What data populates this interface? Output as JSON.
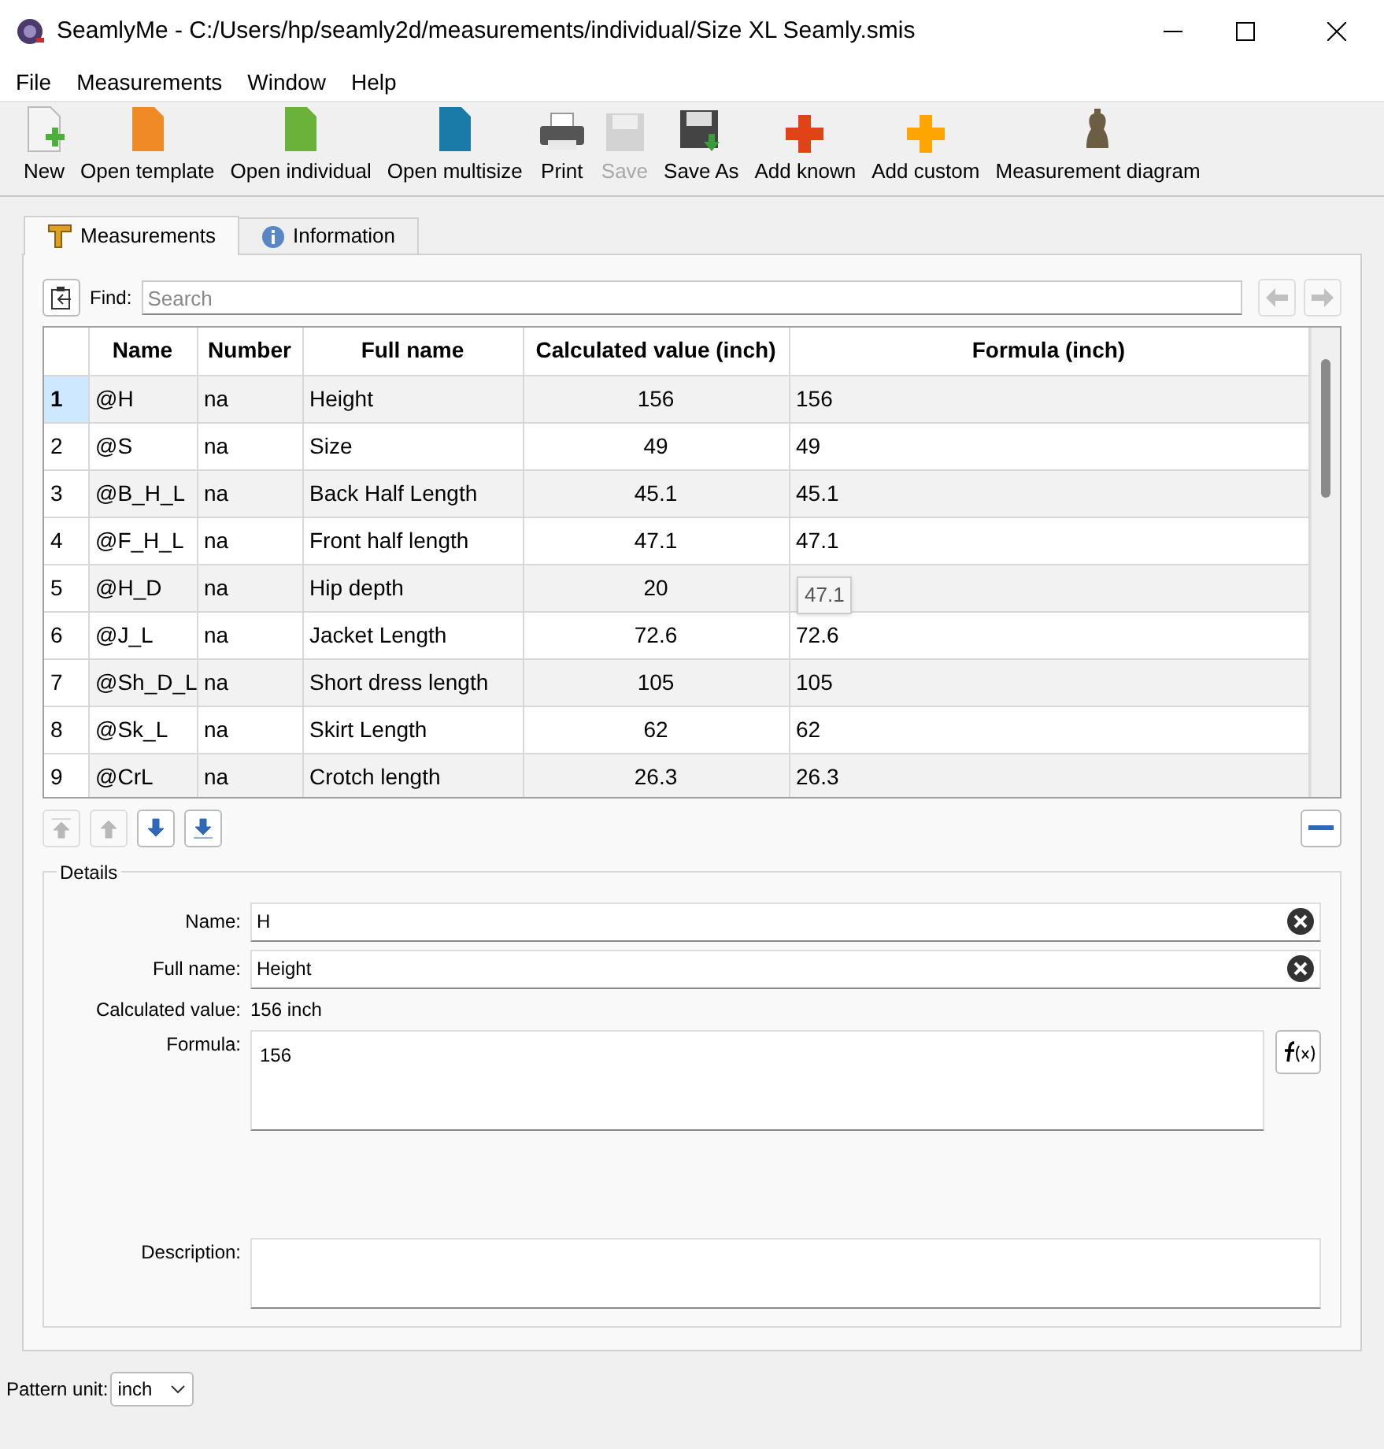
{
  "window": {
    "title": "SeamlyMe - C:/Users/hp/seamly2d/measurements/individual/Size XL Seamly.smis"
  },
  "menu": [
    "File",
    "Measurements",
    "Window",
    "Help"
  ],
  "toolbar": [
    {
      "kind": "new",
      "label": "New",
      "disabled": false
    },
    {
      "kind": "template",
      "label": "Open template",
      "disabled": false
    },
    {
      "kind": "individual",
      "label": "Open individual",
      "disabled": false
    },
    {
      "kind": "multisize",
      "label": "Open multisize",
      "disabled": false
    },
    {
      "kind": "print",
      "label": "Print",
      "disabled": false
    },
    {
      "kind": "save",
      "label": "Save",
      "disabled": true
    },
    {
      "kind": "saveas",
      "label": "Save As",
      "disabled": false
    },
    {
      "kind": "known",
      "label": "Add known",
      "disabled": false
    },
    {
      "kind": "custom",
      "label": "Add custom",
      "disabled": false
    },
    {
      "kind": "diagram",
      "label": "Measurement diagram",
      "disabled": false
    }
  ],
  "tabs": [
    {
      "kind": "measure",
      "label": "Measurements",
      "selected": true
    },
    {
      "kind": "info",
      "label": "Information",
      "selected": false
    }
  ],
  "find": {
    "label": "Find:",
    "placeholder": "Search"
  },
  "table": {
    "columns": [
      "Name",
      "Number",
      "Full name",
      "Calculated value (inch)",
      "Formula (inch)"
    ],
    "rows": [
      {
        "index": "1",
        "selected": true,
        "cells": [
          "@H",
          "na",
          "Height",
          "156",
          "156"
        ]
      },
      {
        "index": "2",
        "selected": false,
        "cells": [
          "@S",
          "na",
          "Size",
          "49",
          "49"
        ]
      },
      {
        "index": "3",
        "selected": false,
        "cells": [
          "@B_H_L",
          "na",
          "Back Half Length",
          "45.1",
          "45.1"
        ]
      },
      {
        "index": "4",
        "selected": false,
        "cells": [
          "@F_H_L",
          "na",
          "Front half length",
          "47.1",
          "47.1"
        ]
      },
      {
        "index": "5",
        "selected": false,
        "cells": [
          "@H_D",
          "na",
          "Hip depth",
          "20",
          ""
        ]
      },
      {
        "index": "6",
        "selected": false,
        "cells": [
          "@J_L",
          "na",
          "Jacket Length",
          "72.6",
          "72.6"
        ]
      },
      {
        "index": "7",
        "selected": false,
        "cells": [
          "@Sh_D_L",
          "na",
          "Short dress length",
          "105",
          "105"
        ]
      },
      {
        "index": "8",
        "selected": false,
        "cells": [
          "@Sk_L",
          "na",
          "Skirt Length",
          "62",
          "62"
        ]
      },
      {
        "index": "9",
        "selected": false,
        "cells": [
          "@CrL",
          "na",
          "Crotch length",
          "26.3",
          "26.3"
        ]
      }
    ],
    "tooltip": "47.1"
  },
  "move_buttons": [
    {
      "kind": "top",
      "disabled": true
    },
    {
      "kind": "up",
      "disabled": true
    },
    {
      "kind": "down",
      "disabled": false
    },
    {
      "kind": "bottom",
      "disabled": false
    }
  ],
  "details": {
    "title": "Details",
    "name_label": "Name:",
    "name": "H",
    "full_name_label": "Full name:",
    "full_name": "Height",
    "calc_label": "Calculated value:",
    "calc": "156 inch",
    "formula_label": "Formula:",
    "formula": "156",
    "description_label": "Description:"
  },
  "pattern_unit": {
    "label": "Pattern unit:",
    "value": "inch"
  }
}
